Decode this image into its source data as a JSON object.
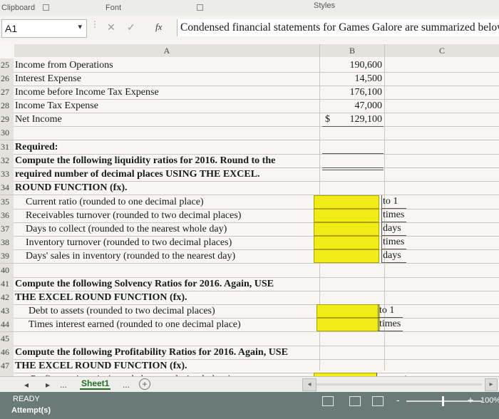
{
  "ribbon": {
    "clipboard": "Clipboard",
    "font": "Font",
    "styles": "Styles"
  },
  "formula_bar": {
    "name_box": "A1",
    "fx": "fx",
    "content": "Condensed financial statements for Games Galore are summarized below:"
  },
  "columns": [
    "A",
    "B",
    "C"
  ],
  "rows": [
    {
      "num": "25",
      "text": "Income from Operations",
      "bold": false,
      "value": "190,600"
    },
    {
      "num": "26",
      "text": "Interest Expense",
      "bold": false,
      "value": "14,500"
    },
    {
      "num": "27",
      "text": "Income before Income Tax Expense",
      "bold": false,
      "value": "176,100"
    },
    {
      "num": "28",
      "text": "Income Tax Expense",
      "bold": false,
      "value": "47,000"
    },
    {
      "num": "29",
      "text": "Net Income",
      "bold": false,
      "value": "129,100",
      "currency": "$"
    },
    {
      "num": "30",
      "text": ""
    },
    {
      "num": "31",
      "text": "Required:",
      "bold": true
    },
    {
      "num": "32",
      "text": "Compute the following liquidity ratios for 2016. Round to the",
      "bold": true
    },
    {
      "num": "33",
      "text": "required number of decimal places USING THE EXCEL.",
      "bold": true
    },
    {
      "num": "34",
      "text": "ROUND FUNCTION (fx).",
      "bold": true
    },
    {
      "num": "35",
      "text": "Current ratio (rounded to one decimal place)",
      "unit": "to 1"
    },
    {
      "num": "36",
      "text": "Receivables turnover (rounded to two decimal places)",
      "unit": "times"
    },
    {
      "num": "37",
      "text": "Days to collect (rounded to the nearest whole day)",
      "unit": "days"
    },
    {
      "num": "38",
      "text": "Inventory turnover (rounded to two decimal places)",
      "unit": "times"
    },
    {
      "num": "39",
      "text": "Days' sales in inventory (rounded to the nearest day)",
      "unit": "days"
    },
    {
      "num": "40",
      "text": ""
    },
    {
      "num": "41",
      "text": "Compute the following Solvency Ratios for 2016. Again, USE",
      "bold": true
    },
    {
      "num": "42",
      "text": "THE EXCEL ROUND FUNCTION (fx).",
      "bold": true
    },
    {
      "num": "43",
      "text": "Debt to assets (rounded to two decimal places)",
      "unit": "to 1"
    },
    {
      "num": "44",
      "text": "Times interest earned (rounded to one decimal place)",
      "unit": "times"
    },
    {
      "num": "45",
      "text": ""
    },
    {
      "num": "46",
      "text": "Compute the following Profitability Ratios for 2016. Again, USE",
      "bold": true
    },
    {
      "num": "47",
      "text": "THE EXCEL ROUND FUNCTION (fx).",
      "bold": true
    },
    {
      "num": "48",
      "text": "Profit margin ratio (rounded to one decimal place)",
      "unit": "percent"
    }
  ],
  "sheet_tabs": {
    "prev": "◂",
    "next": "▸",
    "more": "...",
    "active": "Sheet1",
    "more2": "...",
    "add": "+"
  },
  "status_bar": {
    "ready": "READY",
    "attempts": "Attempt(s)",
    "zoom": "100%"
  },
  "colors": {
    "input_fill": "#f2ec16",
    "status_bar": "#6a7a78"
  }
}
